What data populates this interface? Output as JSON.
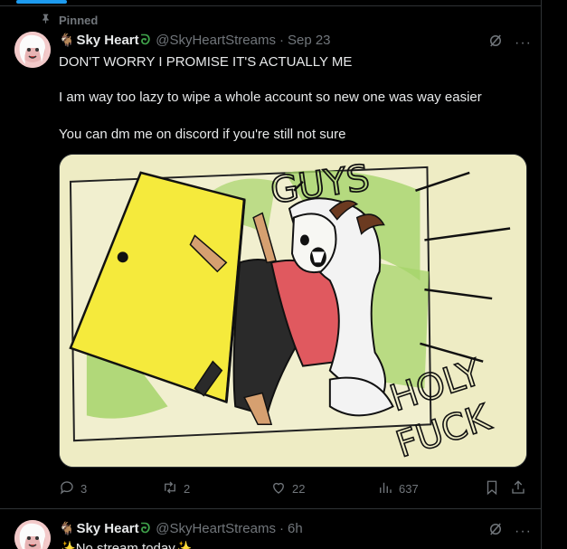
{
  "pinned": {
    "label": "Pinned",
    "icon": "pin-icon"
  },
  "tweet1": {
    "display_name": "Sky Heart",
    "handle": "@SkyHeartStreams",
    "separator": "·",
    "time": "Sep 23",
    "more": "···",
    "lines": [
      "DON'T WORRY I PROMISE IT'S ACTUALLY ME",
      "I am way too lazy to wipe a whole account so new one was way easier",
      "You can dm me on discord if you're still not sure"
    ],
    "media": {
      "text_top": "GUYS",
      "text_bottom_1": "HOLY",
      "text_bottom_2": "FUCK"
    },
    "stats": {
      "replies": "3",
      "reposts": "2",
      "likes": "22",
      "views": "637"
    }
  },
  "tweet2": {
    "display_name": "Sky Heart",
    "handle": "@SkyHeartStreams",
    "separator": "·",
    "time": "6h",
    "more": "···",
    "text": "No stream today",
    "sparkle": "✨"
  },
  "colors": {
    "accent": "#1d9bf0",
    "muted": "#71767b",
    "text": "#e7e9ea",
    "background": "#000000"
  }
}
